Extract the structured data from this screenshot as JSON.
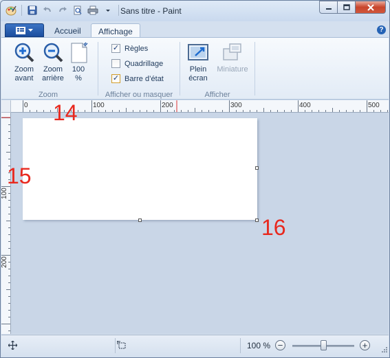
{
  "window": {
    "title": "Sans titre - Paint"
  },
  "tabs": {
    "home_label": "Accueil",
    "view_label": "Affichage"
  },
  "zoom_group": {
    "zoom_in_line1": "Zoom",
    "zoom_in_line2": "avant",
    "zoom_out_line1": "Zoom",
    "zoom_out_line2": "arrière",
    "actual_line1": "100",
    "actual_line2": "%",
    "label": "Zoom"
  },
  "show_hide_group": {
    "rulers_label": "Règles",
    "rulers_checked": true,
    "gridlines_label": "Quadrillage",
    "gridlines_checked": false,
    "statusbar_label": "Barre d’état",
    "statusbar_checked": true,
    "label": "Afficher ou masquer"
  },
  "display_group": {
    "fullscreen_line1": "Plein",
    "fullscreen_line2": "écran",
    "thumbnail_label": "Miniature",
    "label": "Afficher"
  },
  "ruler": {
    "h_ticks": [
      "0",
      "100",
      "200",
      "300",
      "400",
      "500"
    ],
    "v_ticks": [
      "100",
      "200"
    ]
  },
  "callouts": {
    "c14": "14",
    "c15": "15",
    "c16": "16"
  },
  "status": {
    "zoom_text": "100 %",
    "zoom_level_percent": 100,
    "zoom_minus": "−",
    "zoom_plus": "+"
  },
  "colors": {
    "accent_blue": "#1b4e9f",
    "callout_red": "#e8281e",
    "canvas_bg": "#c9d6e7"
  }
}
